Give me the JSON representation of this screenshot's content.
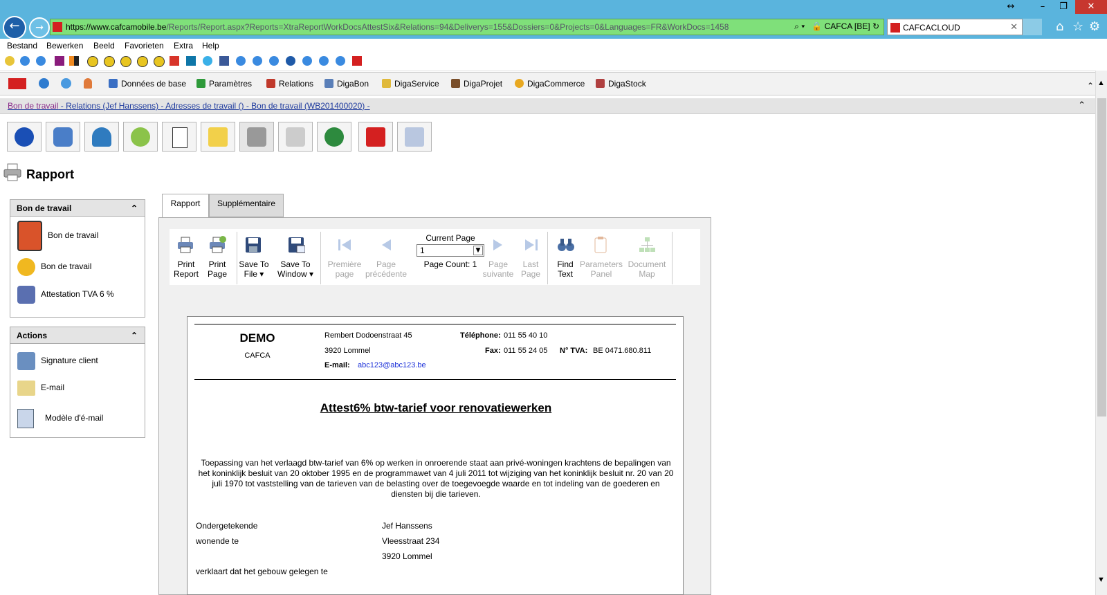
{
  "browser": {
    "url_host": "https://www.cafcamobile.be",
    "url_path": "/Reports/Report.aspx?Reports=XtraReportWorkDocsAttestSix&Relations=94&Deliverys=155&Dossiers=0&Projects=0&Languages=FR&WorkDocs=1458",
    "site_identity": "CAFCA [BE]",
    "tab_title": "CAFCACLOUD",
    "menus": [
      "Bestand",
      "Bewerken",
      "Beeld",
      "Favorieten",
      "Extra",
      "Help"
    ]
  },
  "app_toolbar": {
    "items": [
      {
        "label": "Données de base",
        "color": "#3a6fc4"
      },
      {
        "label": "Paramètres",
        "color": "#2e9a3a"
      },
      {
        "label": "Relations",
        "color": "#c0392b"
      },
      {
        "label": "DigaBon",
        "color": "#5a7fb8"
      },
      {
        "label": "DigaService",
        "color": "#e0b93a"
      },
      {
        "label": "DigaProjet",
        "color": "#7a4f2a"
      },
      {
        "label": "DigaCommerce",
        "color": "#e8a820"
      },
      {
        "label": "DigaStock",
        "color": "#b04040"
      }
    ]
  },
  "breadcrumb": {
    "first": "Bon de travail",
    "rest": "Relations (Jef Hanssens) - Adresses de travail () - Bon de travail (WB201400020) -"
  },
  "page_title": "Rapport",
  "panels": {
    "bon": {
      "title": "Bon de travail",
      "items": [
        "Bon de travail",
        "Bon de travail",
        "Attestation TVA 6 %"
      ]
    },
    "actions": {
      "title": "Actions",
      "items": [
        "Signature client",
        "E-mail",
        "Modèle d'é-mail"
      ]
    }
  },
  "tabs": [
    "Rapport",
    "Supplémentaire"
  ],
  "report_toolbar": {
    "print_report": [
      "Print",
      "Report"
    ],
    "print_page": [
      "Print",
      "Page"
    ],
    "save_file": [
      "Save To",
      "File ▾"
    ],
    "save_window": [
      "Save To",
      "Window ▾"
    ],
    "first_page": [
      "Première",
      "page"
    ],
    "prev_page": [
      "Page",
      "précédente"
    ],
    "current_page_label": "Current Page",
    "current_page_value": "1",
    "page_count": "Page Count: 1",
    "next_page": [
      "Page",
      "suivante"
    ],
    "last_page": [
      "Last",
      "Page"
    ],
    "find_text": [
      "Find",
      "Text"
    ],
    "parameters_panel": [
      "Parameters",
      "Panel"
    ],
    "document_map": [
      "Document",
      "Map"
    ]
  },
  "document": {
    "company": "DEMO",
    "company_sub": "CAFCA",
    "street": "Rembert Dodoenstraat 45",
    "city": "3920 Lommel",
    "email_label": "E-mail:",
    "email": "abc123@abc123.be",
    "phone_label": "Téléphone:",
    "phone": "011 55 40 10",
    "fax_label": "Fax:",
    "fax": "011 55 24 05",
    "vat_label": "N° TVA:",
    "vat": "BE 0471.680.811",
    "title": "Attest6% btw-tarief voor renovatiewerken",
    "paragraph": "Toepassing van het verlaagd btw-tarief van 6% op werken in onroerende staat aan privé-woningen krachtens de bepalingen van het koninklijk besluit van 20 oktober 1995 en de programmawet van 4 juli 2011 tot wijziging van het koninklijk besluit nr. 20 van 20 juli 1970 tot vaststelling van de tarieven van de belasting over de toegevoegde waarde en tot indeling van de goederen en diensten bij die tarieven.",
    "undersigned_label": "Ondergetekende",
    "undersigned_value": "Jef Hanssens",
    "residing_label": "wonende te",
    "residing_street": "Vleesstraat 234",
    "residing_city": "3920 Lommel",
    "declares": "verklaart dat het gebouw gelegen te"
  }
}
